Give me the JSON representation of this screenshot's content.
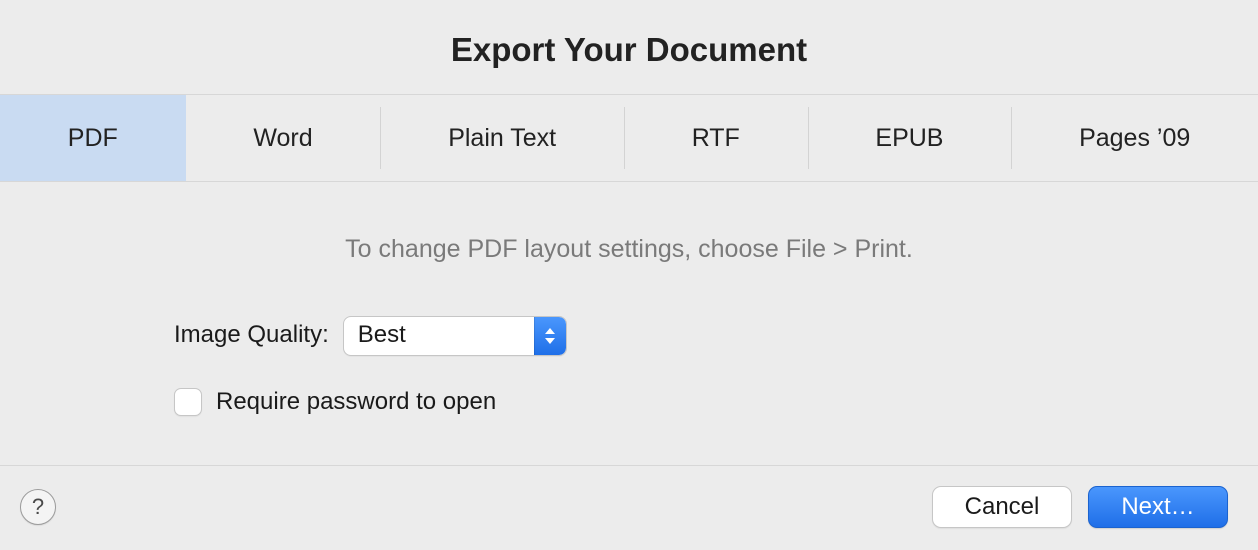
{
  "dialog": {
    "title": "Export Your Document",
    "hint": "To change PDF layout settings, choose File > Print."
  },
  "tabs": {
    "active_index": 0,
    "items": [
      {
        "label": "PDF"
      },
      {
        "label": "Word"
      },
      {
        "label": "Plain Text"
      },
      {
        "label": "RTF"
      },
      {
        "label": "EPUB"
      },
      {
        "label": "Pages ’09"
      }
    ]
  },
  "image_quality": {
    "label": "Image Quality:",
    "value": "Best"
  },
  "require_password": {
    "label": "Require password to open",
    "checked": false
  },
  "footer": {
    "help_label": "?",
    "cancel_label": "Cancel",
    "next_label": "Next…"
  }
}
